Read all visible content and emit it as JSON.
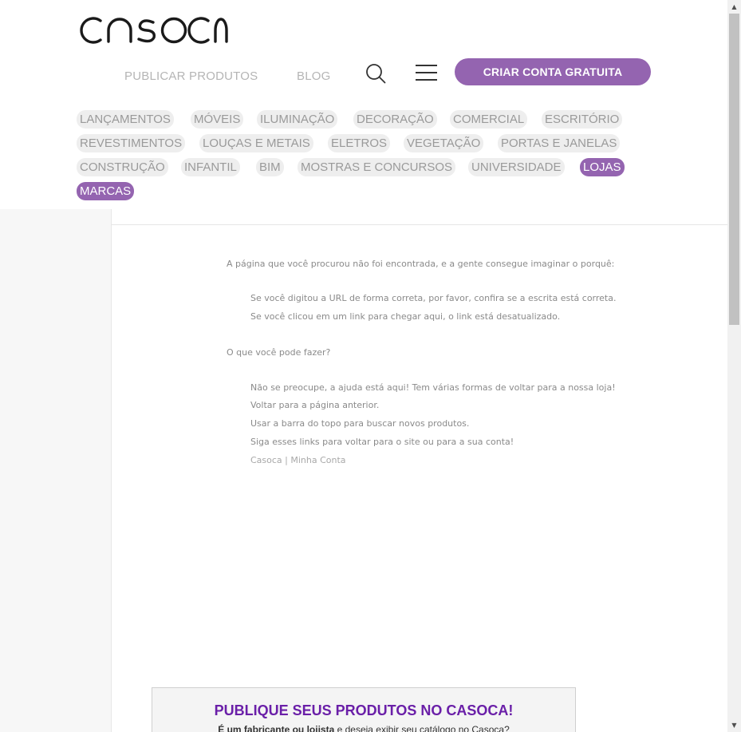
{
  "brand": {
    "logo_text": "CASOCA",
    "accent_color": "#9464b0"
  },
  "header": {
    "nav": [
      {
        "label": "PUBLICAR PRODUTOS"
      },
      {
        "label": "BLOG"
      }
    ],
    "search_icon": "search-icon",
    "menu_icon": "hamburger-menu-icon",
    "cta_label": "CRIAR CONTA GRATUITA"
  },
  "categories": [
    {
      "label": "LANÇAMENTOS",
      "active": false
    },
    {
      "label": "MÓVEIS",
      "active": false
    },
    {
      "label": "ILUMINAÇÃO",
      "active": false
    },
    {
      "label": "DECORAÇÃO",
      "active": false
    },
    {
      "label": "COMERCIAL",
      "active": false
    },
    {
      "label": "ESCRITÓRIO",
      "active": false
    },
    {
      "label": "REVESTIMENTOS",
      "active": false
    },
    {
      "label": "LOUÇAS E METAIS",
      "active": false
    },
    {
      "label": "ELETROS",
      "active": false
    },
    {
      "label": "VEGETAÇÃO",
      "active": false
    },
    {
      "label": "PORTAS E JANELAS",
      "active": false
    },
    {
      "label": "CONSTRUÇÃO",
      "active": false
    },
    {
      "label": "INFANTIL",
      "active": false
    },
    {
      "label": "BIM",
      "active": false
    },
    {
      "label": "MOSTRAS E CONCURSOS",
      "active": false
    },
    {
      "label": "UNIVERSIDADE",
      "active": false
    },
    {
      "label": "LOJAS",
      "active": true
    },
    {
      "label": "MARCAS",
      "active": true
    }
  ],
  "not_found": {
    "intro": "A página que você procurou não foi encontrada, e a gente consegue imaginar o porquê:",
    "reasons": [
      "Se você digitou a URL de forma correta, por favor, confira se a escrita está correta.",
      "Se você clicou em um link para chegar aqui, o link está desatualizado."
    ],
    "what_to_do_title": "O que você pode fazer?",
    "actions": [
      "Não se preocupe, a ajuda está aqui! Tem várias formas de voltar para a nossa loja!",
      "Voltar para a página anterior.",
      "Usar a barra do topo para buscar novos produtos.",
      "Siga esses links para voltar para o site ou para a sua conta!"
    ],
    "links": {
      "site": "Casoca",
      "separator": " | ",
      "account": "Minha Conta"
    }
  },
  "promo": {
    "title": "PUBLIQUE SEUS PRODUTOS NO CASOCA!",
    "subtitle_bold": "É um fabricante ou lojista",
    "subtitle_rest": " e deseja exibir seu catálogo no Casoca?"
  }
}
